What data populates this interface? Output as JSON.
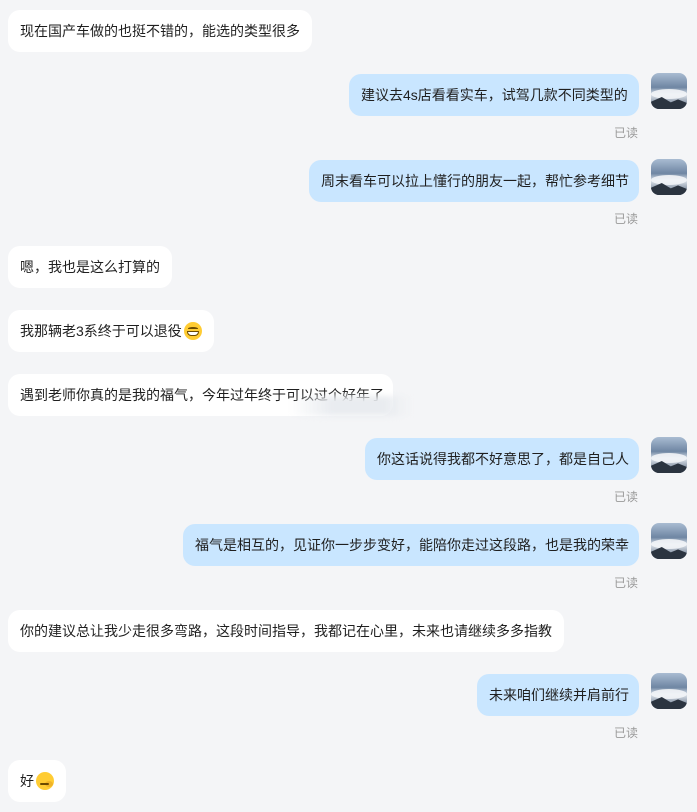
{
  "read_label": "已读",
  "messages": [
    {
      "side": "left",
      "text": "现在国产车做的也挺不错的，能选的类型很多"
    },
    {
      "side": "right",
      "text": "建议去4s店看看实车，试驾几款不同类型的"
    },
    {
      "side": "right",
      "text": "周末看车可以拉上懂行的朋友一起，帮忙参考细节"
    },
    {
      "side": "left",
      "text": "嗯，我也是这么打算的"
    },
    {
      "side": "left",
      "text": "我那辆老3系终于可以退役",
      "emoji": "grinning-face-emoji"
    },
    {
      "side": "left",
      "text": "遇到老师你真的是我的福气，今年过年终于可以过个好年了"
    },
    {
      "side": "right",
      "text": "你这话说得我都不好意思了，都是自己人"
    },
    {
      "side": "right",
      "text": "福气是相互的，见证你一步步变好，能陪你走过这段路，也是我的荣幸"
    },
    {
      "side": "left",
      "text": "你的建议总让我少走很多弯路，这段时间指导，我都记在心里，未来也请继续多多指教"
    },
    {
      "side": "right",
      "text": "未来咱们继续并肩前行"
    },
    {
      "side": "left",
      "text": "好",
      "emoji": "smirking-face-emoji"
    }
  ]
}
